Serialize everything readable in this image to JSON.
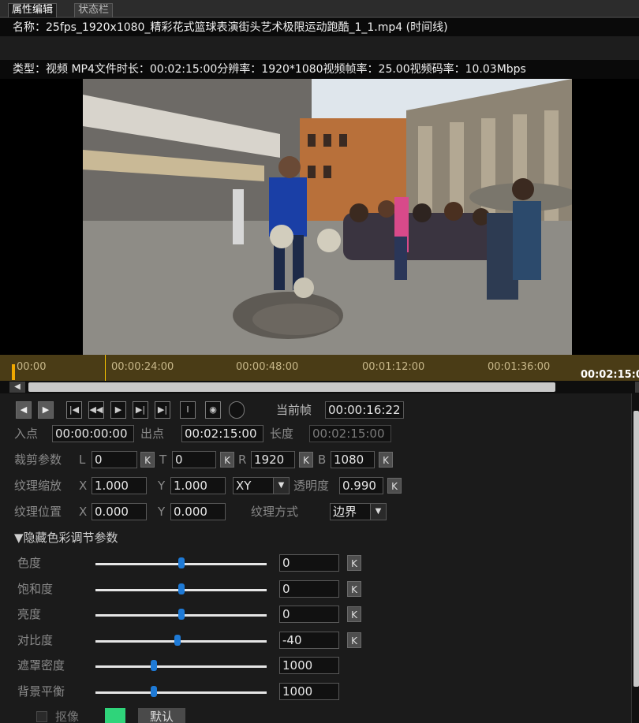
{
  "tabs": [
    {
      "label": "属性编辑",
      "active": true
    },
    {
      "label": "状态栏",
      "active": false
    }
  ],
  "info": {
    "name_line": "名称：25fps_1920x1080_精彩花式篮球表演街头艺术极限运动跑酷_1_1.mp4 (时间线)",
    "type_line": "类型：视频 MP4文件时长：00:02:15:00分辨率：1920*1080视频帧率：25.00视频码率：10.03Mbps"
  },
  "timeline": {
    "ticks": [
      "00:00",
      "00:00:24:00",
      "00:00:48:00",
      "00:01:12:00",
      "00:01:36:00"
    ],
    "end": "00:02:15:0",
    "cursor_color": "#f7c400"
  },
  "transport": {
    "icons": [
      "prev-arrow-icon",
      "next-arrow-icon",
      "go-start-icon",
      "step-back-icon",
      "play-icon",
      "step-forward-icon",
      "go-end-icon",
      "text-icon",
      "snapshot-icon",
      "circle-icon"
    ],
    "current_frame_label": "当前帧",
    "current_frame_value": "00:00:16:22"
  },
  "inout": {
    "in_label": "入点",
    "in_value": "00:00:00:00",
    "out_label": "出点",
    "out_value": "00:02:15:00",
    "length_label": "长度",
    "length_value": "00:02:15:00"
  },
  "crop": {
    "label": "裁剪参数",
    "l_label": "L",
    "l_value": "0",
    "t_label": "T",
    "t_value": "0",
    "r_label": "R",
    "r_value": "1920",
    "b_label": "B",
    "b_value": "1080",
    "k": "K"
  },
  "scale": {
    "label": "纹理缩放",
    "x_label": "X",
    "x_value": "1.000",
    "y_label": "Y",
    "y_value": "1.000",
    "mode_value": "XY",
    "opacity_label": "透明度",
    "opacity_value": "0.990",
    "k": "K"
  },
  "position": {
    "label": "纹理位置",
    "x_label": "X",
    "x_value": "0.000",
    "y_label": "Y",
    "y_value": "0.000",
    "mode_label": "纹理方式",
    "mode_value": "边界"
  },
  "color_section": {
    "title": "▼隐藏色彩调节参数",
    "sliders": [
      {
        "label": "色度",
        "value": "0",
        "level": 0.5,
        "k": "K"
      },
      {
        "label": "饱和度",
        "value": "0",
        "level": 0.5,
        "k": "K"
      },
      {
        "label": "亮度",
        "value": "0",
        "level": 0.5,
        "k": "K"
      },
      {
        "label": "对比度",
        "value": "-40",
        "level": 0.48,
        "k": "K"
      },
      {
        "label": "遮罩密度",
        "value": "1000",
        "level": 0.34
      },
      {
        "label": "背景平衡",
        "value": "1000",
        "level": 0.34
      }
    ]
  },
  "keying": {
    "label": "抠像",
    "swatch_color": "#2fd47a",
    "default_label": "默认"
  },
  "colors": {
    "accent_blue": "#1e7ad6",
    "timeline_bg": "#4a3c16"
  }
}
